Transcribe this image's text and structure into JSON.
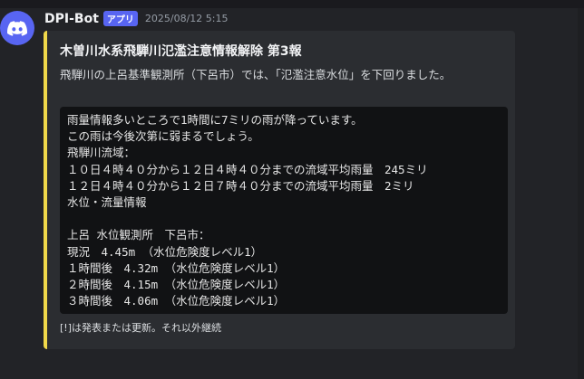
{
  "message": {
    "username": "DPI-Bot",
    "badge": "アプリ",
    "timestamp": "2025/08/12 5:15",
    "avatar_icon": "discord-logo-icon",
    "accent_color": "#f0d84a"
  },
  "embed": {
    "title": "木曽川水系飛騨川氾濫注意情報解除 第3報",
    "description": "飛騨川の上呂基準観測所（下呂市）では、「氾濫注意水位」を下回りました。",
    "code_lines": [
      "雨量情報多いところで1時間に7ミリの雨が降っています。",
      "この雨は今後次第に弱まるでしょう。",
      "飛騨川流域：",
      "１０日４時４０分から１２日４時４０分までの流域平均雨量　245ミリ",
      "１２日４時４０分から１２日７時４０分までの流域平均雨量　2ミリ",
      "水位・流量情報",
      "",
      "上呂 水位観測所　下呂市：",
      "現況　4.45m （水位危険度レベル1）",
      "１時間後　4.32m （水位危険度レベル1）",
      "２時間後　4.15m （水位危険度レベル1）",
      "３時間後　4.06m （水位危険度レベル1）"
    ],
    "footer": "[!]は発表または更新。それ以外継続"
  }
}
